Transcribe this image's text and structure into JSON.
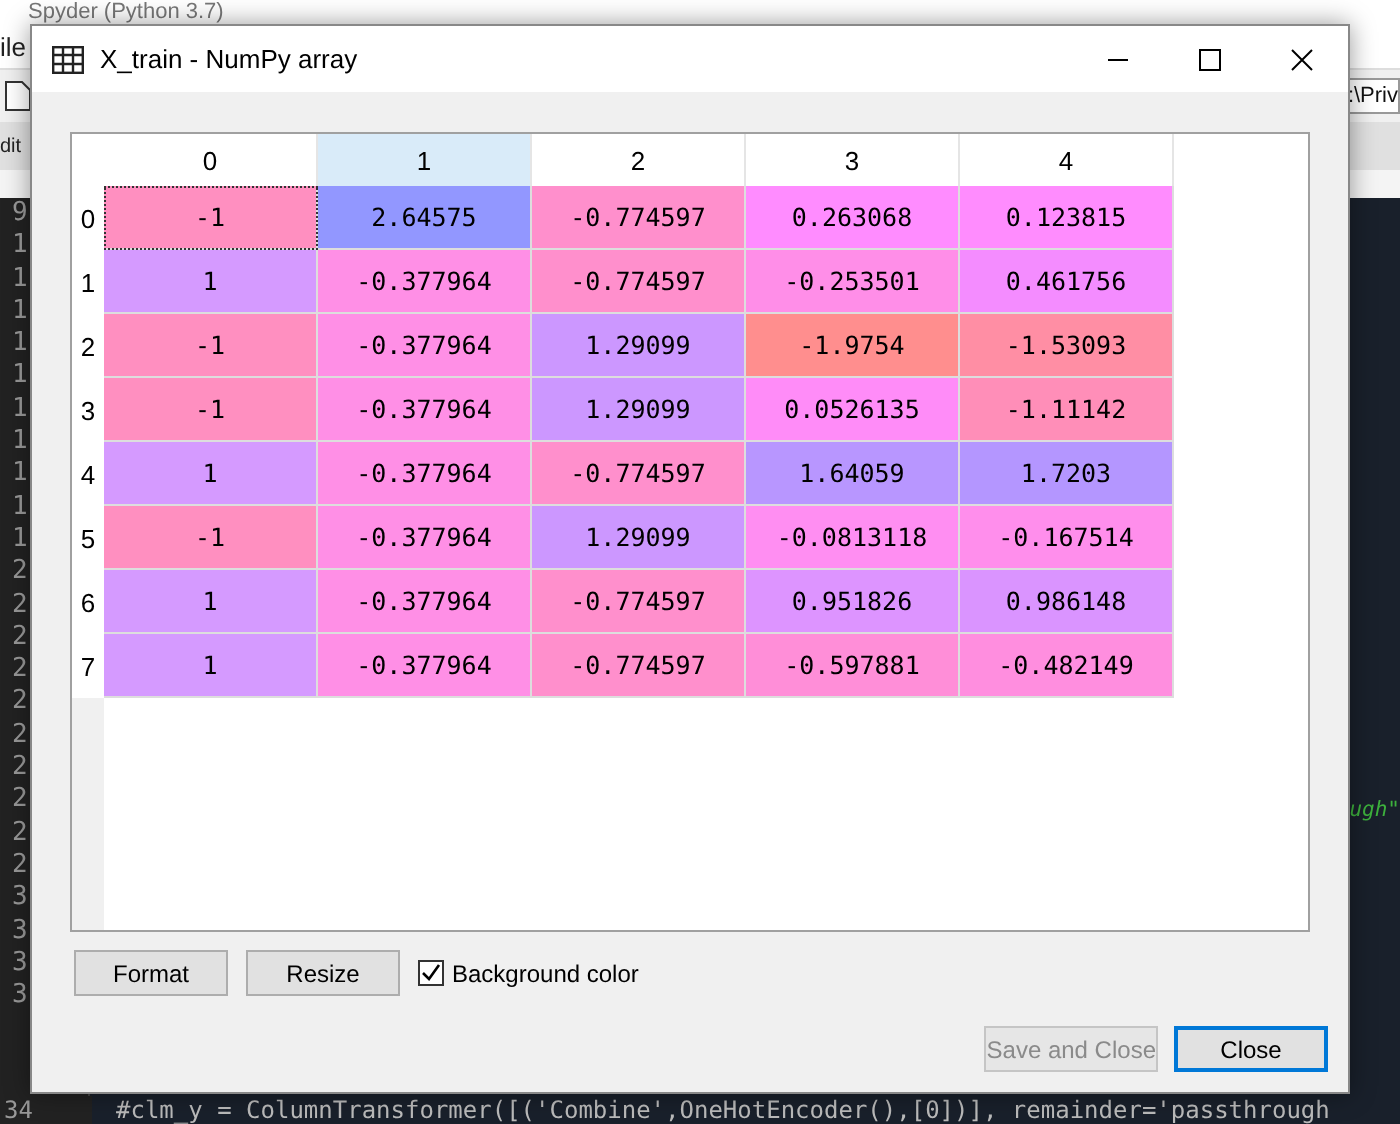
{
  "background_app": {
    "title": "Spyder (Python 3.7)",
    "menu": "ile",
    "path": ":\\Priv",
    "tab": "dit",
    "line_numbers": [
      "9",
      "1",
      "1",
      "1",
      "1",
      "1",
      "1",
      "1",
      "1",
      "1",
      "1",
      "2",
      "2",
      "2",
      "2",
      "2",
      "2",
      "2",
      "2",
      "2",
      "2",
      "3",
      "3",
      "3",
      "3"
    ],
    "code_fragment": "ugh\"",
    "last_line_number": "34",
    "last_line": "#clm_y = ColumnTransformer([('Combine',OneHotEncoder(),[0])], remainder='passthrough"
  },
  "window": {
    "title": "X_train - NumPy array"
  },
  "table": {
    "columns": [
      {
        "label": "0",
        "selected": false
      },
      {
        "label": "1",
        "selected": true
      },
      {
        "label": "2",
        "selected": false
      },
      {
        "label": "3",
        "selected": false
      },
      {
        "label": "4",
        "selected": false
      }
    ],
    "rows": [
      {
        "label": "0",
        "cells": [
          {
            "value": "-1",
            "color": "#ff8fc0",
            "focused": true
          },
          {
            "value": "2.64575",
            "color": "#9297ff",
            "focused": false
          },
          {
            "value": "-0.774597",
            "color": "#ff8fcc",
            "focused": false
          },
          {
            "value": "0.263068",
            "color": "#ff8cff",
            "focused": false
          },
          {
            "value": "0.123815",
            "color": "#ff8cfe",
            "focused": false
          }
        ]
      },
      {
        "label": "1",
        "cells": [
          {
            "value": "1",
            "color": "#d59aff",
            "focused": false
          },
          {
            "value": "-0.377964",
            "color": "#ff8fe6",
            "focused": false
          },
          {
            "value": "-0.774597",
            "color": "#ff8fcc",
            "focused": false
          },
          {
            "value": "-0.253501",
            "color": "#ff8ee8",
            "focused": false
          },
          {
            "value": "0.461756",
            "color": "#f48cff",
            "focused": false
          }
        ]
      },
      {
        "label": "2",
        "cells": [
          {
            "value": "-1",
            "color": "#ff8fc0",
            "focused": false
          },
          {
            "value": "-0.377964",
            "color": "#ff8fe6",
            "focused": false
          },
          {
            "value": "1.29099",
            "color": "#cc97ff",
            "focused": false
          },
          {
            "value": "-1.9754",
            "color": "#ff8e8e",
            "focused": false
          },
          {
            "value": "-1.53093",
            "color": "#ff8ea4",
            "focused": false
          }
        ]
      },
      {
        "label": "3",
        "cells": [
          {
            "value": "-1",
            "color": "#ff8fc0",
            "focused": false
          },
          {
            "value": "-0.377964",
            "color": "#ff8fe6",
            "focused": false
          },
          {
            "value": "1.29099",
            "color": "#cc97ff",
            "focused": false
          },
          {
            "value": "0.0526135",
            "color": "#ff8cf8",
            "focused": false
          },
          {
            "value": "-1.11142",
            "color": "#ff8eb8",
            "focused": false
          }
        ]
      },
      {
        "label": "4",
        "cells": [
          {
            "value": "1",
            "color": "#d59aff",
            "focused": false
          },
          {
            "value": "-0.377964",
            "color": "#ff8fe6",
            "focused": false
          },
          {
            "value": "-0.774597",
            "color": "#ff8fcc",
            "focused": false
          },
          {
            "value": "1.64059",
            "color": "#b896ff",
            "focused": false
          },
          {
            "value": "1.7203",
            "color": "#b496ff",
            "focused": false
          }
        ]
      },
      {
        "label": "5",
        "cells": [
          {
            "value": "-1",
            "color": "#ff8fc0",
            "focused": false
          },
          {
            "value": "-0.377964",
            "color": "#ff8fe6",
            "focused": false
          },
          {
            "value": "1.29099",
            "color": "#cc97ff",
            "focused": false
          },
          {
            "value": "-0.0813118",
            "color": "#ff8ef2",
            "focused": false
          },
          {
            "value": "-0.167514",
            "color": "#ff8eec",
            "focused": false
          }
        ]
      },
      {
        "label": "6",
        "cells": [
          {
            "value": "1",
            "color": "#d59aff",
            "focused": false
          },
          {
            "value": "-0.377964",
            "color": "#ff8fe6",
            "focused": false
          },
          {
            "value": "-0.774597",
            "color": "#ff8fcc",
            "focused": false
          },
          {
            "value": "0.951826",
            "color": "#dd94ff",
            "focused": false
          },
          {
            "value": "0.986148",
            "color": "#da94ff",
            "focused": false
          }
        ]
      },
      {
        "label": "7",
        "cells": [
          {
            "value": "1",
            "color": "#d59aff",
            "focused": false
          },
          {
            "value": "-0.377964",
            "color": "#ff8fe6",
            "focused": false
          },
          {
            "value": "-0.774597",
            "color": "#ff8fcc",
            "focused": false
          },
          {
            "value": "-0.597881",
            "color": "#ff8ed8",
            "focused": false
          },
          {
            "value": "-0.482149",
            "color": "#ff8edf",
            "focused": false
          }
        ]
      }
    ]
  },
  "tools": [
    {
      "label": "Format"
    },
    {
      "label": "Resize"
    }
  ],
  "background_color": {
    "label": "Background color",
    "checked": true
  },
  "buttons": [
    {
      "label": "Save and Close",
      "disabled": true,
      "default": false
    },
    {
      "label": "Close",
      "disabled": false,
      "default": true
    }
  ]
}
